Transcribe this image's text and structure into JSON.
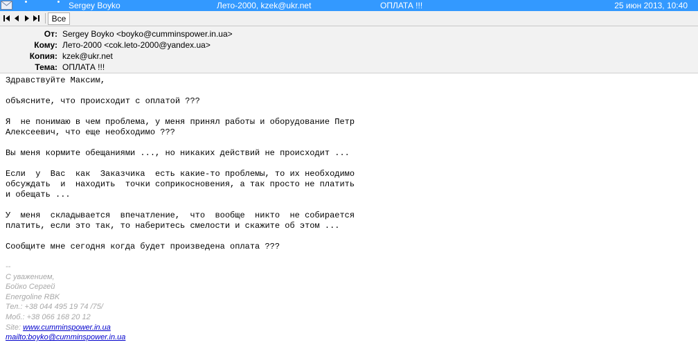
{
  "message_row": {
    "sender": "Sergey Boyko",
    "recipients": "Лето-2000, kzek@ukr.net",
    "subject": "ОПЛАТА !!!",
    "date": "25 июн 2013, 10:40",
    "icon": "envelope-icon"
  },
  "nav": {
    "tab_label": "Все",
    "buttons": [
      "first-icon",
      "prev-icon",
      "next-icon",
      "last-icon"
    ]
  },
  "header": {
    "from_label": "От:",
    "from_value": "Sergey Boyko <boyko@cumminspower.in.ua>",
    "to_label": "Кому:",
    "to_value": "Лето-2000 <cok.leto-2000@yandex.ua>",
    "cc_label": "Копия:",
    "cc_value": "kzek@ukr.net",
    "subject_label": "Тема:",
    "subject_value": "ОПЛАТА !!!"
  },
  "body_lines": [
    "Здравствуйте Максим,",
    "",
    "объясните, что происходит с оплатой ???",
    "",
    "Я  не понимаю в чем проблема, у меня принял работы и оборудование Петр",
    "Алексеевич, что еще необходимо ???",
    "",
    "Вы меня кормите обещаниями ..., но никаких действий не происходит ...",
    "",
    "Если  у  Вас  как  Заказчика  есть какие-то проблемы, то их необходимо",
    "обсуждать  и  находить  точки соприкосновения, а так просто не платить",
    "и обещать ...",
    "",
    "У  меня  складывается  впечатление,  что  вообще  никто  не собирается",
    "платить, если это так, то наберитесь смелости и скажите об этом ...",
    "",
    "Сообщите мне сегодня когда будет произведена оплата ???"
  ],
  "signature": {
    "dashes": "--",
    "regards": "С уважением,",
    "name": "Бойко Сергей",
    "company": "Energoline RBK",
    "phone": "Тел.: +38 044 495 19 74 /75/",
    "mobile": "Моб.: +38 066 168 20 12",
    "site_label": "Site:",
    "site_link": "www.cumminspower.in.ua",
    "mailto_link": "mailto:boyko@cumminspower.in.ua"
  },
  "colors": {
    "selection": "#3399ff",
    "header_bg": "#f2f2f2",
    "link": "#0000cc",
    "signature": "#a8a8a8"
  }
}
